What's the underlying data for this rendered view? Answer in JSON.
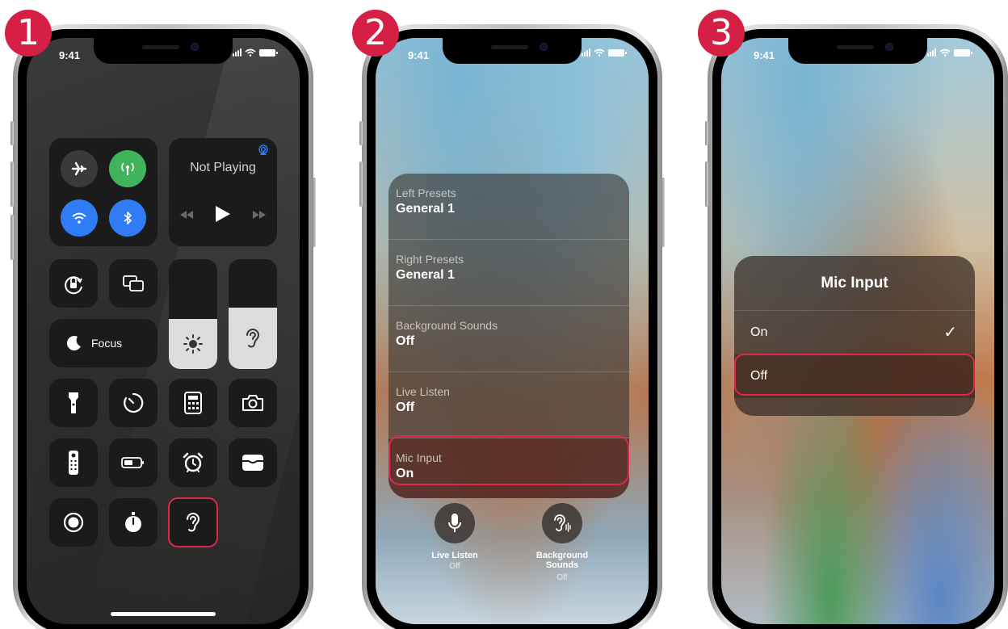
{
  "steps": [
    "1",
    "2",
    "3"
  ],
  "phone1": {
    "status_time": "9:41",
    "media_title": "Not Playing",
    "focus_label": "Focus",
    "colors": {
      "highlight": "#e1264e",
      "toggle_green": "#3fb45a",
      "toggle_blue": "#2f7cf6"
    }
  },
  "phone2": {
    "status_time": "9:41",
    "rows": [
      {
        "title": "Left Presets",
        "value": "General 1"
      },
      {
        "title": "Right Presets",
        "value": "General 1"
      },
      {
        "title": "Background Sounds",
        "value": "Off"
      },
      {
        "title": "Live Listen",
        "value": "Off"
      },
      {
        "title": "Mic Input",
        "value": "On"
      }
    ],
    "buttons": [
      {
        "label": "Live Listen",
        "sub": "Off",
        "icon": "microphone-icon"
      },
      {
        "label": "Background\nSounds",
        "sub": "Off",
        "icon": "ear-sound-icon"
      }
    ]
  },
  "phone3": {
    "status_time": "9:41",
    "title": "Mic Input",
    "options": [
      {
        "label": "On",
        "checked": true
      },
      {
        "label": "Off",
        "checked": false
      }
    ],
    "check_glyph": "✓"
  }
}
